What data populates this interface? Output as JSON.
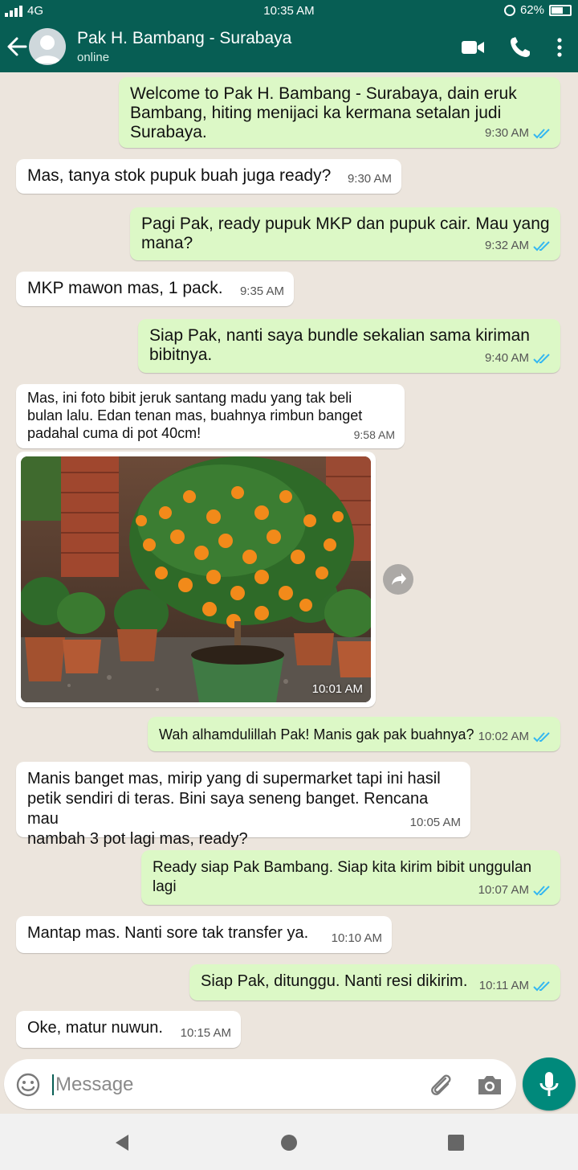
{
  "status_bar": {
    "network": "4G",
    "time": "10:35 AM",
    "battery": "62%"
  },
  "header": {
    "contact_name": "Pak H. Bambang - Surabaya",
    "status": "online"
  },
  "messages": [
    {
      "dir": "out",
      "text": "Welcome to Pak H. Bambang - Surabaya, dain eruk\nBambang, hiting menijaci ka kermana setalan judi\nSurabaya.",
      "time": "9:30 AM"
    },
    {
      "dir": "in",
      "text": "Mas, tanya stok pupuk buah juga ready?",
      "time": "9:30 AM"
    },
    {
      "dir": "out",
      "text": "Pagi Pak, ready pupuk MKP dan pupuk cair. Mau yang\nmana?",
      "time": "9:32 AM"
    },
    {
      "dir": "in",
      "text": "MKP mawon mas, 1 pack.",
      "time": "9:35 AM"
    },
    {
      "dir": "out",
      "text": "Siap Pak, nanti saya bundle sekalian sama kiriman\nbibitnya.",
      "time": "9:40 AM"
    },
    {
      "dir": "in",
      "text": "Mas, ini foto bibit jeruk santang madu yang tak beli\nbulan lalu. Edan tenan mas, buahnya rimbun banget\npadahal cuma di pot 40cm!",
      "time": "9:58 AM"
    },
    {
      "dir": "in",
      "type": "image",
      "time": "10:01 AM"
    },
    {
      "dir": "out",
      "text": "Wah alhamdulillah Pak! Manis gak pak buahnya?",
      "time": "10:02 AM"
    },
    {
      "dir": "in",
      "text": "Manis banget mas, mirip yang di supermarket tapi ini hasil\npetik sendiri di teras. Bini saya seneng banget. Rencana mau\nnambah 3 pot lagi mas, ready?",
      "time": "10:05 AM"
    },
    {
      "dir": "out",
      "text": "Ready siap Pak Bambang. Siap kita kirim bibit unggulan lagi",
      "time": "10:07 AM"
    },
    {
      "dir": "in",
      "text": "Mantap mas. Nanti sore tak transfer ya.",
      "time": "10:10 AM"
    },
    {
      "dir": "out",
      "text": "Siap Pak, ditunggu. Nanti resi dikirim.",
      "time": "10:11 AM"
    },
    {
      "dir": "in",
      "text": "Oke, matur nuwun.",
      "time": "10:15 AM"
    }
  ],
  "input": {
    "placeholder": "Message"
  },
  "colors": {
    "header": "#075e54",
    "outgoing": "#dcf8c6",
    "incoming": "#ffffff",
    "background": "#ece5dd",
    "ticks": "#34b7f1",
    "mic": "#00897b"
  },
  "icons": {
    "back": "arrow-left-icon",
    "video": "video-call-icon",
    "call": "phone-icon",
    "menu": "more-vert-icon",
    "emoji": "emoji-icon",
    "attach": "paperclip-icon",
    "camera": "camera-icon",
    "mic": "mic-icon",
    "share": "forward-icon"
  }
}
